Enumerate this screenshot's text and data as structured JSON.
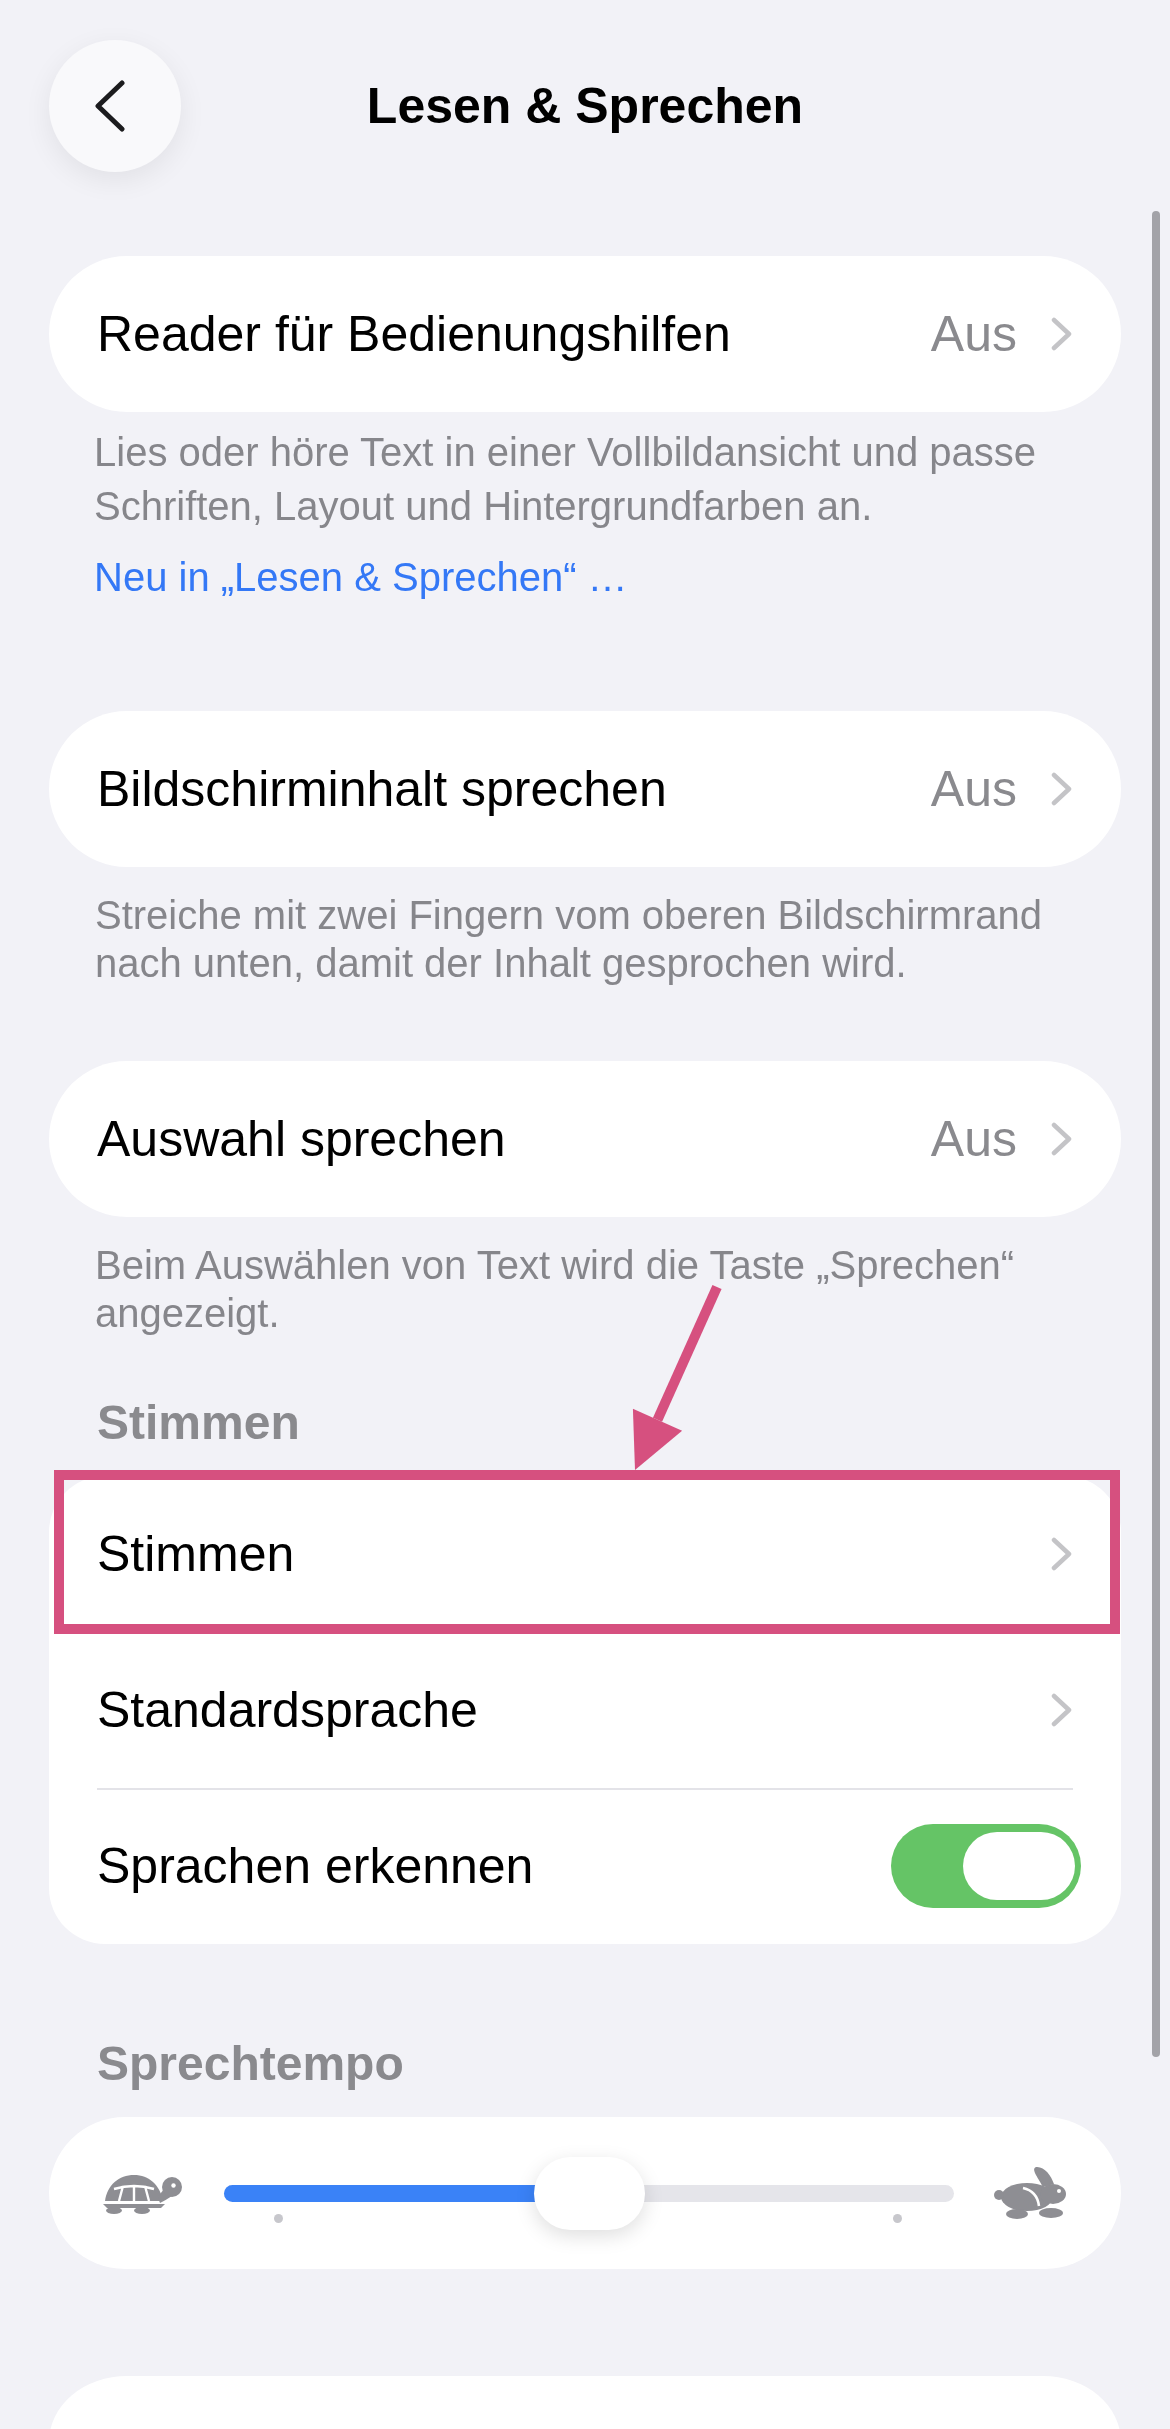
{
  "nav": {
    "title": "Lesen & Sprechen"
  },
  "sections": [
    {
      "kind": "card",
      "rows": [
        {
          "kind": "link",
          "label": "Reader für Bedienungshilfen",
          "value": "Aus",
          "highlighted": false
        }
      ],
      "footer": {
        "text": "Lies oder höre Text in einer Vollbildansicht und passe Schriften, Layout und Hintergrundfarben an.",
        "link": "Neu in „Lesen & Sprechen“ …"
      }
    },
    {
      "kind": "card",
      "rows": [
        {
          "kind": "link",
          "label": "Bildschirminhalt sprechen",
          "value": "Aus",
          "highlighted": false
        }
      ],
      "footer": {
        "text": "Streiche mit zwei Fingern vom oberen Bildschirmrand nach unten, damit der Inhalt gesprochen wird."
      }
    },
    {
      "kind": "card",
      "rows": [
        {
          "kind": "link",
          "label": "Auswahl sprechen",
          "value": "Aus",
          "highlighted": false
        }
      ],
      "footer": {
        "text": "Beim Auswählen von Text wird die Taste „Sprechen“ angezeigt."
      }
    },
    {
      "kind": "card",
      "header": "Stimmen",
      "rows": [
        {
          "kind": "link",
          "label": "Stimmen",
          "highlighted": true
        },
        {
          "kind": "link",
          "label": "Standardsprache",
          "highlighted": false
        },
        {
          "kind": "toggle",
          "label": "Sprachen erkennen",
          "on": true,
          "highlighted": false
        }
      ]
    },
    {
      "kind": "slider",
      "header": "Sprechtempo",
      "level": 0.5
    },
    {
      "kind": "peek"
    }
  ]
}
